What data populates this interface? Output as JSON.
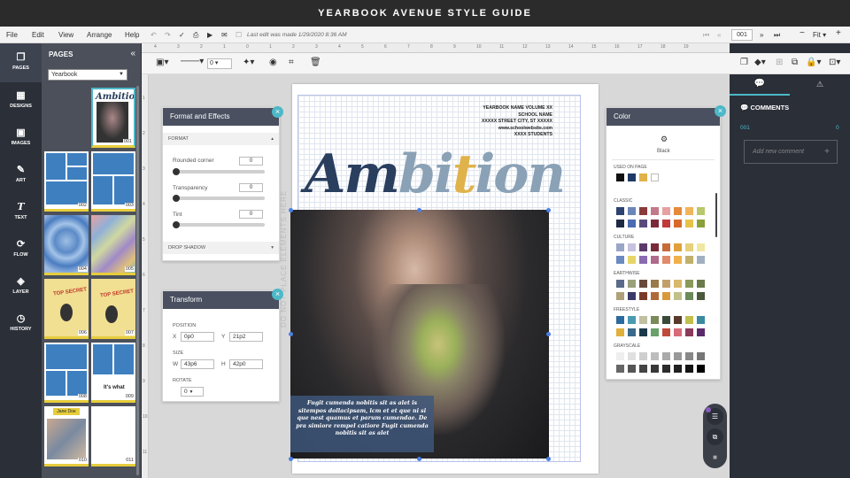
{
  "app_title": "YEARBOOK AVENUE STYLE GUIDE",
  "menu": [
    "File",
    "Edit",
    "View",
    "Arrange",
    "Help"
  ],
  "last_edit": "Last edit was made 1/29/2020 8:36 AM",
  "page_number": "001",
  "zoom": "Fit",
  "left_rail": [
    {
      "label": "PAGES",
      "icon": "pages-icon"
    },
    {
      "label": "DESIGNS",
      "icon": "designs-icon"
    },
    {
      "label": "IMAGES",
      "icon": "images-icon"
    },
    {
      "label": "ART",
      "icon": "art-icon"
    },
    {
      "label": "TEXT",
      "icon": "text-icon"
    },
    {
      "label": "FLOW",
      "icon": "flow-icon"
    },
    {
      "label": "LAYER",
      "icon": "layer-icon"
    },
    {
      "label": "HISTORY",
      "icon": "history-icon"
    }
  ],
  "pages_panel": {
    "title": "PAGES",
    "book": "Yearbook",
    "thumbs": [
      "001",
      "002",
      "003",
      "004",
      "005",
      "006",
      "007",
      "008",
      "009",
      "010",
      "011"
    ],
    "thumb_texts": {
      "t001": "Ambition",
      "t006": "TOP SECRET",
      "t007": "TOP SECRET",
      "t009": "It's what",
      "t010": "Jane Doe"
    }
  },
  "toolbar": {
    "stroke_width": "0"
  },
  "ruler_top": [
    "4",
    "3",
    "2",
    "1",
    "0",
    "1",
    "2",
    "3",
    "4",
    "5",
    "6",
    "7",
    "8",
    "9",
    "10",
    "11",
    "12",
    "13",
    "14",
    "15",
    "16",
    "17",
    "18",
    "19"
  ],
  "ruler_left": [
    "1",
    "2",
    "3",
    "4",
    "5",
    "6",
    "7",
    "8",
    "9",
    "10",
    "11"
  ],
  "page": {
    "school_info": [
      "YEARBOOK NAME   VOLUME XX",
      "SCHOOL NAME",
      "XXXXX STREET   CITY, ST XXXXX",
      "www.schoolwebsite.com",
      "XXXX STUDENTS"
    ],
    "headline": {
      "a": "Am",
      "b": "bi",
      "i": "t",
      "c": "ion"
    },
    "vertical_note": "DO NOT PLACE ELEMENTS HERE",
    "caption": "Fugit cumenda nobitis sit as alet is sitempos dollacipsam, lcm et et que ni si que nest quamus et parum cumendae. De pra simiore rempel catiore Fugit cumenda nobitis sit as alet"
  },
  "format_panel": {
    "title": "Format and Effects",
    "section": "FORMAT",
    "rows": [
      {
        "label": "Rounded corner",
        "value": "0"
      },
      {
        "label": "Transparency",
        "value": "0"
      },
      {
        "label": "Tint",
        "value": "0"
      }
    ],
    "drop_shadow": "DROP SHADOW"
  },
  "transform_panel": {
    "title": "Transform",
    "position_label": "POSITION",
    "x": "0p0",
    "y": "21p2",
    "size_label": "SIZE",
    "w": "43p6",
    "h": "42p0",
    "rotate_label": "ROTATE",
    "rotate": "0"
  },
  "color_panel": {
    "title": "Color",
    "black_label": "Black",
    "used_on_page": "USED ON PAGE",
    "used": [
      "#111111",
      "#1f3a66",
      "#e0b24a",
      "#ffffff"
    ],
    "palettes": [
      {
        "name": "CLASSIC",
        "rows": [
          [
            "#2c4270",
            "#6b86b8",
            "#8a3b3b",
            "#c27a8a",
            "#e6a0a0",
            "#e58a3a",
            "#f2b45a",
            "#b8c86a"
          ],
          [
            "#1e2a44",
            "#4b6cb0",
            "#5a4a7a",
            "#7a2a3a",
            "#c03a3a",
            "#d86a2a",
            "#e6c24a",
            "#8aa03a"
          ]
        ]
      },
      {
        "name": "CULTURE",
        "rows": [
          [
            "#9aa6c8",
            "#c7c2e0",
            "#5a3a6a",
            "#7a2a3a",
            "#c86a3a",
            "#e0a03a",
            "#e6d07a",
            "#f0e8a0"
          ],
          [
            "#6a8ac0",
            "#e6d66a",
            "#8a6ab0",
            "#b06a8a",
            "#e08a6a",
            "#f0b04a",
            "#c0b06a",
            "#a0b0c0"
          ]
        ]
      },
      {
        "name": "EARTHWISE",
        "rows": [
          [
            "#5a6a8a",
            "#9aa07a",
            "#6a4a3a",
            "#9a7a4a",
            "#c2a06a",
            "#d8b86a",
            "#8a9a5a",
            "#6a7a4a"
          ],
          [
            "#b0a07a",
            "#3a3a6a",
            "#7a3a2a",
            "#b06a3a",
            "#d89a3a",
            "#c0c08a",
            "#6a8a5a",
            "#4a5a3a"
          ]
        ]
      },
      {
        "name": "FREESTYLE",
        "rows": [
          [
            "#2a6aa0",
            "#4a9ab0",
            "#c0c0a0",
            "#7a8a5a",
            "#3a4a3a",
            "#5a3a2a",
            "#c0c04a",
            "#3a8aa0"
          ],
          [
            "#e0b03a",
            "#3a6a8a",
            "#1a3a4a",
            "#6aa06a",
            "#c04a3a",
            "#d86a7a",
            "#8a3a5a",
            "#5a2a6a"
          ]
        ]
      },
      {
        "name": "GRAYSCALE",
        "rows": [
          [
            "#eeeeee",
            "#e0e0e0",
            "#cfcfcf",
            "#bdbdbd",
            "#aaaaaa",
            "#999999",
            "#888888",
            "#777777"
          ],
          [
            "#666666",
            "#555555",
            "#444444",
            "#383838",
            "#2c2c2c",
            "#202020",
            "#141414",
            "#000000"
          ]
        ]
      }
    ]
  },
  "comments": {
    "title": "COMMENTS",
    "page": "001",
    "count": "0",
    "placeholder": "Add new comment"
  }
}
